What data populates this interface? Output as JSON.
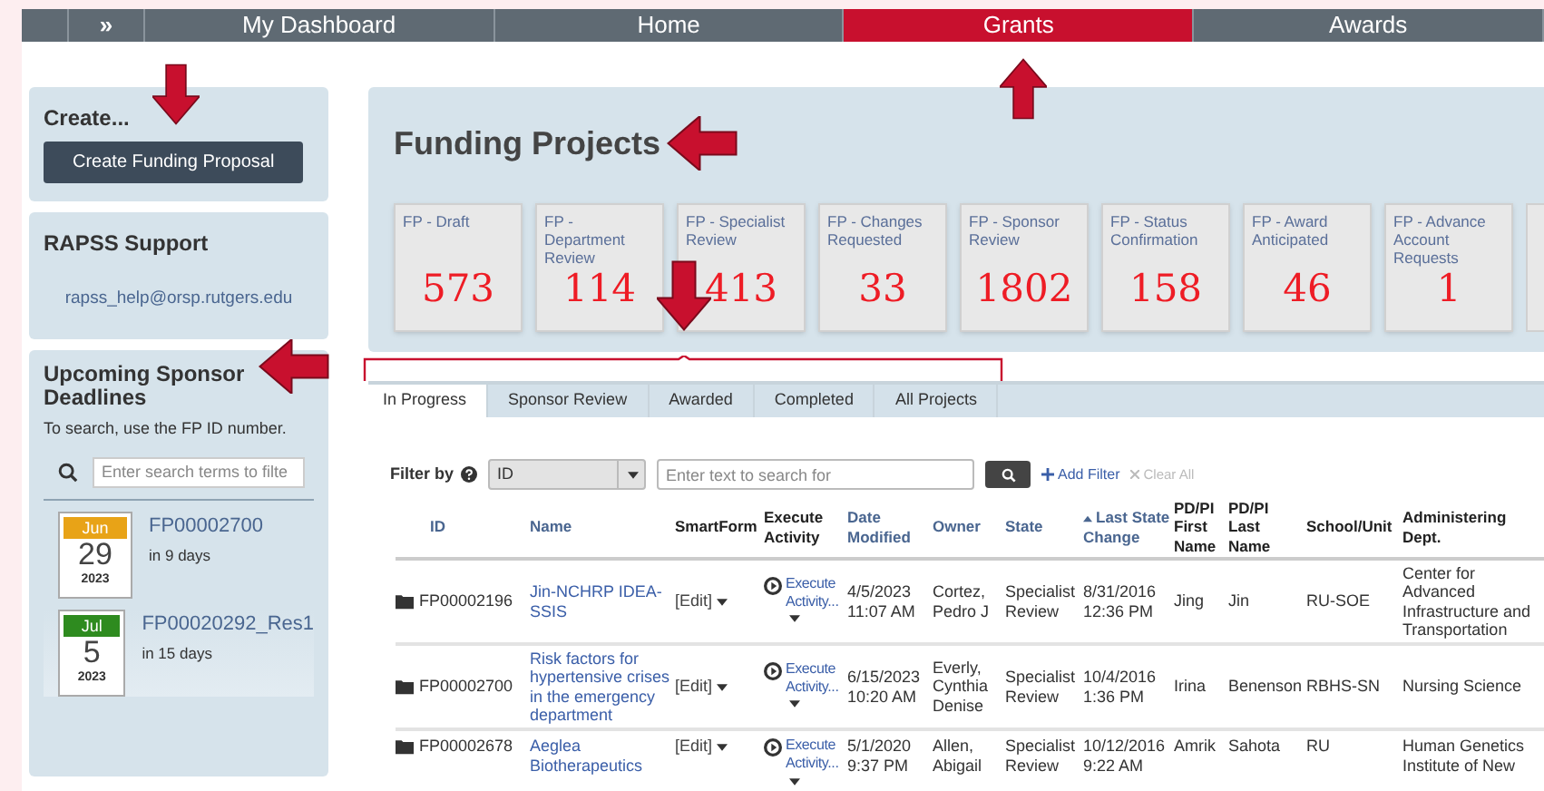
{
  "nav": {
    "toggle": "»",
    "items": [
      {
        "label": "My Dashboard",
        "selected": false
      },
      {
        "label": "Home",
        "selected": false
      },
      {
        "label": "Grants",
        "selected": true
      },
      {
        "label": "Awards",
        "selected": false
      }
    ]
  },
  "sidebar": {
    "create": {
      "title": "Create...",
      "button": "Create Funding Proposal"
    },
    "support": {
      "title": "RAPSS Support",
      "email": "rapss_help@orsp.rutgers.edu"
    },
    "deadlines": {
      "title": "Upcoming Sponsor Deadlines",
      "hint": "To search, use the FP ID number.",
      "search": {
        "placeholder": "Enter search terms to filte"
      },
      "items": [
        {
          "month": "Jun",
          "day": "29",
          "year": "2023",
          "color": "#e8a317",
          "id": "FP00002700",
          "due": "in 9 days"
        },
        {
          "month": "Jul",
          "day": "5",
          "year": "2023",
          "color": "#2e8b1f",
          "id": "FP00020292_Res1",
          "due": "in 15 days"
        }
      ]
    }
  },
  "funding": {
    "title": "Funding Projects",
    "tiles": [
      {
        "label": "FP - Draft",
        "count": "573"
      },
      {
        "label": "FP - Department Review",
        "count": "114"
      },
      {
        "label": "FP - Specialist Review",
        "count": "413"
      },
      {
        "label": "FP - Changes Requested",
        "count": "33"
      },
      {
        "label": "FP - Sponsor Review",
        "count": "1802"
      },
      {
        "label": "FP - Status Confirmation",
        "count": "158"
      },
      {
        "label": "FP - Award Anticipated",
        "count": "46"
      },
      {
        "label": "FP - Advance Account Requests",
        "count": "1"
      }
    ]
  },
  "tabs": [
    {
      "label": "In Progress",
      "selected": true
    },
    {
      "label": "Sponsor Review",
      "selected": false
    },
    {
      "label": "Awarded",
      "selected": false
    },
    {
      "label": "Completed",
      "selected": false
    },
    {
      "label": "All Projects",
      "selected": false
    }
  ],
  "filter": {
    "label": "Filter by",
    "field": "ID",
    "search": {
      "placeholder": "Enter text to search for"
    },
    "add": "Add Filter",
    "clear": "Clear All"
  },
  "table": {
    "columns": [
      {
        "label": "ID",
        "sortable": true,
        "sorted": false
      },
      {
        "label": "Name",
        "sortable": true,
        "sorted": false
      },
      {
        "label": "SmartForm",
        "sortable": false,
        "sorted": false
      },
      {
        "label": "Execute Activity",
        "sortable": false,
        "sorted": false
      },
      {
        "label": "Date Modified",
        "sortable": true,
        "sorted": false
      },
      {
        "label": "Owner",
        "sortable": true,
        "sorted": false
      },
      {
        "label": "State",
        "sortable": true,
        "sorted": false
      },
      {
        "label": "Last State Change",
        "sortable": true,
        "sorted": true
      },
      {
        "label": "PD/PI First Name",
        "sortable": false,
        "sorted": false
      },
      {
        "label": "PD/PI Last Name",
        "sortable": false,
        "sorted": false
      },
      {
        "label": "School/Unit",
        "sortable": false,
        "sorted": false
      },
      {
        "label": "Administering Dept.",
        "sortable": false,
        "sorted": false
      }
    ],
    "rows": [
      {
        "id": "FP00002196",
        "name": "Jin-NCHRP IDEA-SSIS",
        "smartform": "[Edit]",
        "execute": "Execute Activity...",
        "date_modified": "4/5/2023 11:07 AM",
        "owner": "Cortez, Pedro J",
        "state": "Specialist Review",
        "last_state_change": "8/31/2016 12:36 PM",
        "first_name": "Jing",
        "last_name": "Jin",
        "school": "RU-SOE",
        "dept": "Center for Advanced Infrastructure and Transportation"
      },
      {
        "id": "FP00002700",
        "name": "Risk factors for hypertensive crises in the emergency department",
        "smartform": "[Edit]",
        "execute": "Execute Activity...",
        "date_modified": "6/15/2023 10:20 AM",
        "owner": "Everly, Cynthia Denise",
        "state": "Specialist Review",
        "last_state_change": "10/4/2016 1:36 PM",
        "first_name": "Irina",
        "last_name": "Benenson",
        "school": "RBHS-SN",
        "dept": "Nursing Science"
      },
      {
        "id": "FP00002678",
        "name": "Aeglea Biotherapeutics",
        "smartform": "[Edit]",
        "execute": "Execute Activity...",
        "date_modified": "5/1/2020 9:37 PM",
        "owner": "Allen, Abigail",
        "state": "Specialist Review",
        "last_state_change": "10/12/2016 9:22 AM",
        "first_name": "Amrik",
        "last_name": "Sahota",
        "school": "RU",
        "dept": "Human Genetics Institute of New"
      }
    ]
  }
}
